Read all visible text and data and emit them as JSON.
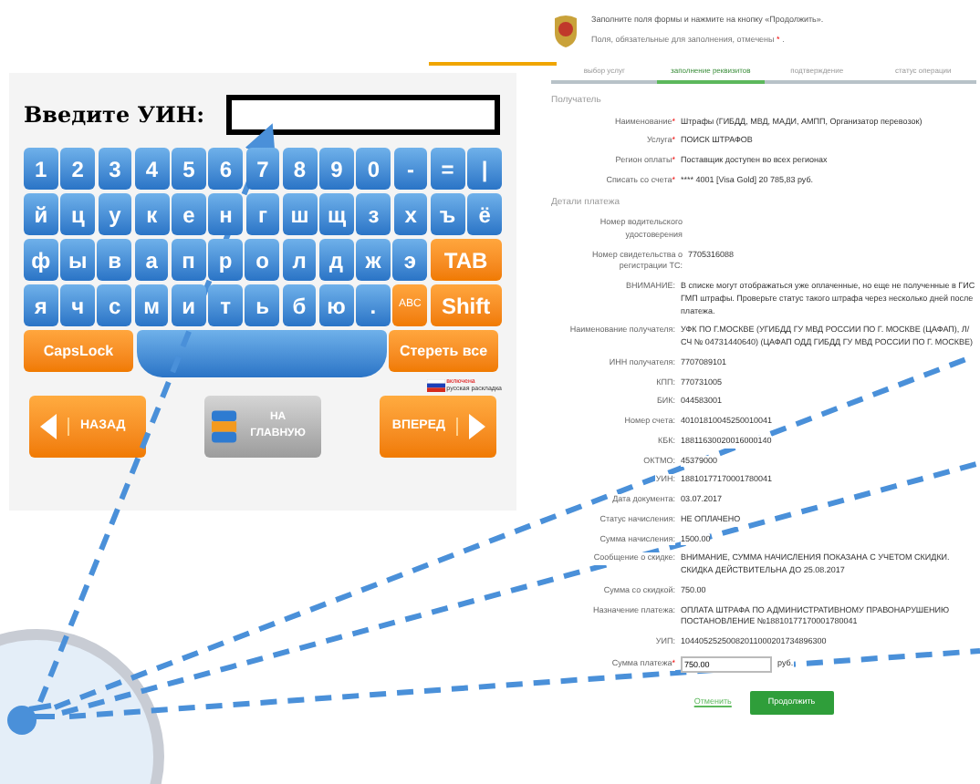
{
  "kiosk": {
    "prompt": "Введите УИН:",
    "keyboard": [
      [
        {
          "label": "1",
          "kind": "key"
        },
        {
          "label": "2",
          "kind": "key"
        },
        {
          "label": "3",
          "kind": "key"
        },
        {
          "label": "4",
          "kind": "key"
        },
        {
          "label": "5",
          "kind": "key"
        },
        {
          "label": "6",
          "kind": "key"
        },
        {
          "label": "7",
          "kind": "key"
        },
        {
          "label": "8",
          "kind": "key"
        },
        {
          "label": "9",
          "kind": "key"
        },
        {
          "label": "0",
          "kind": "key"
        },
        {
          "label": "-",
          "kind": "key"
        },
        {
          "label": "=",
          "kind": "key"
        },
        {
          "label": "|",
          "kind": "key"
        }
      ],
      [
        {
          "label": "й",
          "kind": "key"
        },
        {
          "label": "ц",
          "kind": "key"
        },
        {
          "label": "у",
          "kind": "key"
        },
        {
          "label": "к",
          "kind": "key"
        },
        {
          "label": "е",
          "kind": "key"
        },
        {
          "label": "н",
          "kind": "key"
        },
        {
          "label": "г",
          "kind": "key"
        },
        {
          "label": "ш",
          "kind": "key"
        },
        {
          "label": "щ",
          "kind": "key"
        },
        {
          "label": "з",
          "kind": "key"
        },
        {
          "label": "х",
          "kind": "key"
        },
        {
          "label": "ъ",
          "kind": "key"
        },
        {
          "label": "ё",
          "kind": "key"
        }
      ],
      [
        {
          "label": "ф",
          "kind": "key"
        },
        {
          "label": "ы",
          "kind": "key"
        },
        {
          "label": "в",
          "kind": "key"
        },
        {
          "label": "а",
          "kind": "key"
        },
        {
          "label": "п",
          "kind": "key"
        },
        {
          "label": "р",
          "kind": "key"
        },
        {
          "label": "о",
          "kind": "key"
        },
        {
          "label": "л",
          "kind": "key"
        },
        {
          "label": "д",
          "kind": "key"
        },
        {
          "label": "ж",
          "kind": "key"
        },
        {
          "label": "э",
          "kind": "key"
        },
        {
          "label": "TAB",
          "kind": "wide"
        }
      ],
      [
        {
          "label": "я",
          "kind": "key"
        },
        {
          "label": "ч",
          "kind": "key"
        },
        {
          "label": "с",
          "kind": "key"
        },
        {
          "label": "м",
          "kind": "key"
        },
        {
          "label": "и",
          "kind": "key"
        },
        {
          "label": "т",
          "kind": "key"
        },
        {
          "label": "ь",
          "kind": "key"
        },
        {
          "label": "б",
          "kind": "key"
        },
        {
          "label": "ю",
          "kind": "key"
        },
        {
          "label": ".",
          "kind": "key"
        },
        {
          "label": "ABC",
          "kind": "small"
        },
        {
          "label": "Shift",
          "kind": "wide"
        }
      ],
      [
        {
          "label": "CapsLock",
          "kind": "action"
        },
        {
          "kind": "space"
        },
        {
          "label": "Стереть все",
          "kind": "action"
        }
      ]
    ],
    "layout": {
      "status": "включена",
      "label": "русская раскладка"
    },
    "nav": [
      {
        "label": "НАЗАД",
        "kind": "back"
      },
      {
        "label": "НА ГЛАВНУЮ",
        "kind": "home"
      },
      {
        "label": "ВПЕРЕД",
        "kind": "forward"
      }
    ]
  },
  "form": {
    "intro": "Заполните поля формы и нажмите на кнопку «Продолжить».",
    "required_note": "Поля, обязательные для заполнения, отмечены",
    "required_mark": "*",
    "note_end": ".",
    "steps": [
      {
        "label": "выбор услуг",
        "selected": false
      },
      {
        "label": "заполнение реквизитов",
        "selected": true
      },
      {
        "label": "подтверждение",
        "selected": false
      },
      {
        "label": "статус операции",
        "selected": false
      }
    ],
    "rows": [
      {
        "kind": "heading",
        "text": "Получатель"
      },
      {
        "kind": "field",
        "label": "Наименование",
        "required": true,
        "value": "Штрафы (ГИБДД, МВД, МАДИ, АМПП, Организатор перевозок)"
      },
      {
        "kind": "field",
        "label": "Услуга",
        "required": true,
        "value": "ПОИСК ШТРАФОВ"
      },
      {
        "kind": "field",
        "label": "Регион оплаты",
        "required": true,
        "value": "Поставщик доступен во всех регионах"
      },
      {
        "kind": "field",
        "label": "Списать со счета",
        "required": true,
        "value": "**** 4001 [Visa Gold] 20 785,83 руб."
      },
      {
        "kind": "heading",
        "text": "Детали платежа"
      },
      {
        "kind": "field",
        "label": "Номер водительского удостоверения",
        "required": false
      },
      {
        "kind": "field",
        "label": "Номер свидетельства о регистрации ТС:",
        "required": false,
        "value": "7705316088"
      },
      {
        "kind": "field",
        "label": "ВНИМАНИЕ:",
        "required": false,
        "value": "В списке могут отображаться уже оплаченные, но еще не полученные в ГИС ГМП штрафы. Проверьте статус такого штрафа через несколько дней после платежа."
      },
      {
        "kind": "field",
        "label": "Наименование получателя:",
        "required": false,
        "value": "УФК ПО Г.МОСКВЕ (УГИБДД ГУ МВД РОССИИ ПО Г. МОСКВЕ (ЦАФАП), Л/СЧ № 04731440640) (ЦАФАП ОДД ГИБДД ГУ МВД РОССИИ ПО Г. МОСКВЕ)"
      },
      {
        "kind": "field",
        "label": "ИНН получателя:",
        "required": false,
        "value": "7707089101"
      },
      {
        "kind": "field",
        "label": "КПП:",
        "required": false,
        "value": "770731005"
      },
      {
        "kind": "field",
        "label": "БИК:",
        "required": false,
        "value": "044583001"
      },
      {
        "kind": "field",
        "label": "Номер счета:",
        "required": false,
        "value": "40101810045250010041"
      },
      {
        "kind": "field",
        "label": "КБК:",
        "required": false,
        "value": "18811630020016000140"
      },
      {
        "kind": "field",
        "label": "ОКТМО:",
        "required": false,
        "value": "45379000"
      },
      {
        "kind": "field",
        "label": "УИН:",
        "required": false,
        "value": "18810177170001780041"
      },
      {
        "kind": "field",
        "label": "Дата документа:",
        "required": false,
        "value": "03.07.2017"
      },
      {
        "kind": "field",
        "label": "Статус начисления:",
        "required": false,
        "value": "НЕ ОПЛАЧЕНО"
      },
      {
        "kind": "field",
        "label": "Сумма начисления:",
        "required": false,
        "value": "1500.00"
      },
      {
        "kind": "field",
        "label": "Сообщение о скидке:",
        "required": false,
        "value": "ВНИМАНИЕ, СУММА НАЧИСЛЕНИЯ ПОКАЗАНА С УЧЕТОМ СКИДКИ. СКИДКА ДЕЙСТВИТЕЛЬНА ДО 25.08.2017"
      },
      {
        "kind": "field",
        "label": "Сумма со скидкой:",
        "required": false,
        "value": "750.00"
      },
      {
        "kind": "field",
        "label": "Назначение платежа:",
        "required": false,
        "value": "ОПЛАТА ШТРАФА ПО АДМИНИСТРАТИВНОМУ ПРАВОНАРУШЕНИЮ ПОСТАНОВЛЕНИЕ №18810177170001780041"
      },
      {
        "kind": "field",
        "label": "УИП:",
        "required": false,
        "value": "10440525250082011000201734896300"
      },
      {
        "kind": "input",
        "label": "Сумма платежа",
        "required": true,
        "value": "750.00",
        "unit": "руб."
      }
    ],
    "cancel": "Отменить",
    "submit": "Продолжить"
  }
}
